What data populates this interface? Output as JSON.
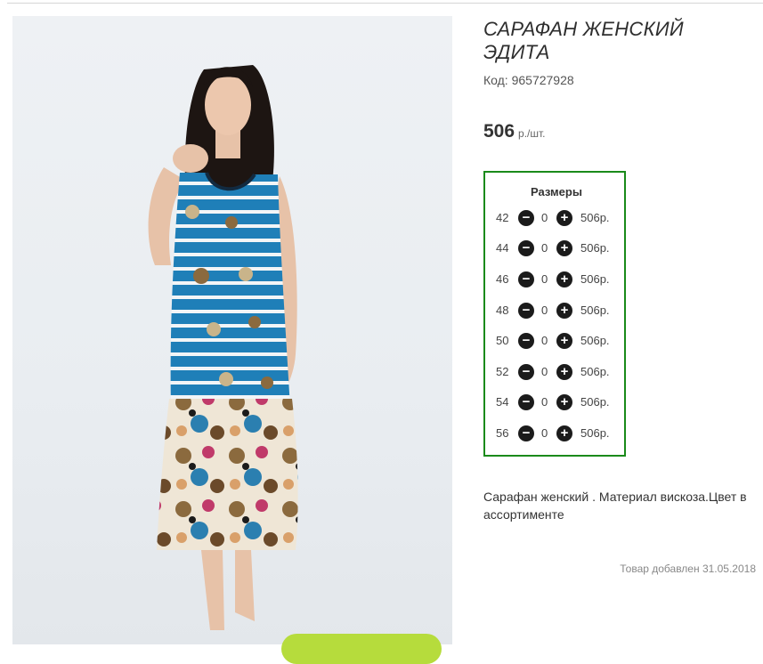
{
  "product": {
    "title": "САРАФАН ЖЕНСКИЙ ЭДИТА",
    "code_label": "Код: 965727928",
    "price_value": "506",
    "price_unit": "р./шт.",
    "description": "Сарафан женский . Материал вискоза.Цвет в ассортименте",
    "added_text": "Товар добавлен 31.05.2018"
  },
  "sizes": {
    "title": "Размеры",
    "minus_symbol": "−",
    "plus_symbol": "+",
    "rows": [
      {
        "size": "42",
        "qty": "0",
        "price": "506р."
      },
      {
        "size": "44",
        "qty": "0",
        "price": "506р."
      },
      {
        "size": "46",
        "qty": "0",
        "price": "506р."
      },
      {
        "size": "48",
        "qty": "0",
        "price": "506р."
      },
      {
        "size": "50",
        "qty": "0",
        "price": "506р."
      },
      {
        "size": "52",
        "qty": "0",
        "price": "506р."
      },
      {
        "size": "54",
        "qty": "0",
        "price": "506р."
      },
      {
        "size": "56",
        "qty": "0",
        "price": "506р."
      }
    ]
  },
  "colors": {
    "border_green": "#1a8a1a",
    "dress_blue": "#1f7fb8",
    "cart_button_green": "#b6dc3c"
  },
  "icons": {
    "minus": "minus-circle-icon",
    "plus": "plus-circle-icon"
  }
}
